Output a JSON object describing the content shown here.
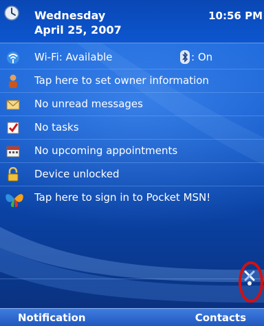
{
  "header": {
    "day": "Wednesday",
    "date": "April 25, 2007",
    "time": "10:56 PM"
  },
  "rows": {
    "wifi": {
      "label": "Wi-Fi: Available",
      "bluetooth_status": ": On",
      "icon": "wifi-icon"
    },
    "owner": {
      "label": "Tap here to set owner information",
      "icon": "owner-icon"
    },
    "messages": {
      "label": "No unread messages",
      "icon": "envelope-icon"
    },
    "tasks": {
      "label": "No tasks",
      "icon": "task-checkbox-icon"
    },
    "appointments": {
      "label": "No upcoming appointments",
      "icon": "calendar-icon"
    },
    "lock": {
      "label": "Device unlocked",
      "icon": "padlock-icon"
    },
    "msn": {
      "label": "Tap here to sign in to Pocket MSN!",
      "icon": "msn-butterfly-icon"
    }
  },
  "softkeys": {
    "left": "Notification",
    "right": "Contacts"
  },
  "colors": {
    "background": "#0f4fb4",
    "highlight_ring": "#d41010",
    "softkey_bar": "#1f56bd"
  }
}
